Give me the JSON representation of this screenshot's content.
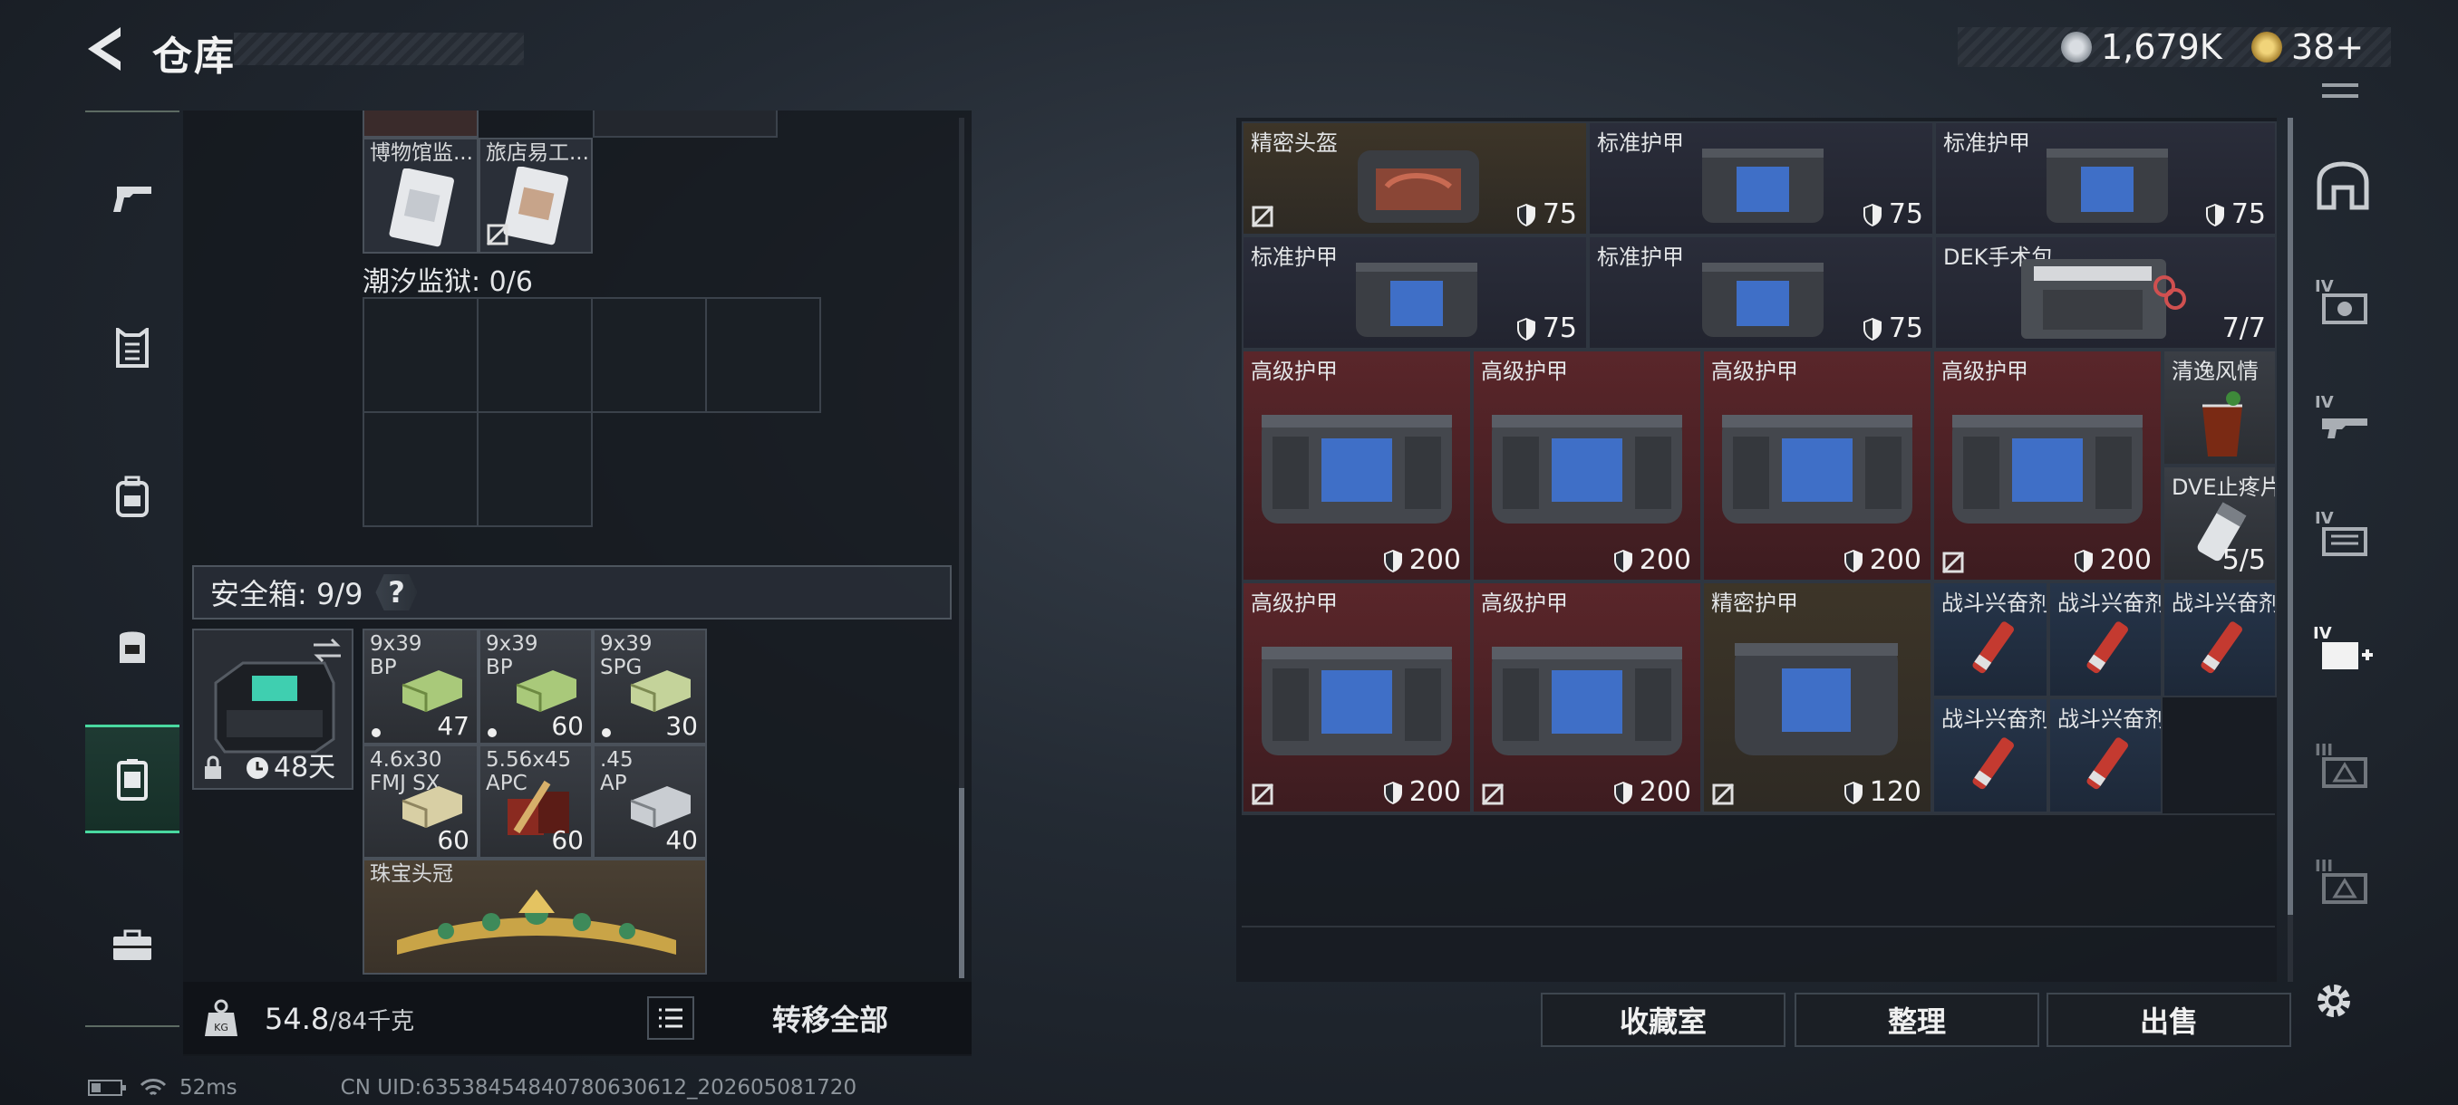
{
  "header": {
    "title": "仓库",
    "currency_silver": "1,679K",
    "currency_gold": "38+"
  },
  "sidebar": {
    "items": [
      "gun-icon",
      "armor-vest-icon",
      "backpack-icon",
      "rig-icon",
      "container-icon",
      "toolbox-icon"
    ]
  },
  "left": {
    "top_items": [
      {
        "name": "博物馆监..."
      },
      {
        "name": "旅店易工..."
      }
    ],
    "prison_label": "潮汐监狱: 0/6",
    "safe_label": "安全箱: 9/9",
    "safe_help": "?",
    "safe_days": "48天",
    "ammo": [
      {
        "name": "9x39\nBP",
        "qty": "47"
      },
      {
        "name": "9x39\nBP",
        "qty": "60"
      },
      {
        "name": "9x39\nSPG",
        "qty": "30"
      },
      {
        "name": "4.6x30\nFMJ SX",
        "qty": "60"
      },
      {
        "name": "5.56x45\nAPC",
        "qty": "60"
      },
      {
        "name": ".45\nAP",
        "qty": "40"
      }
    ],
    "crown_name": "珠宝头冠",
    "weight_value": "54.8",
    "weight_max": "/84千克",
    "transfer_all": "转移全部"
  },
  "right": {
    "items": [
      {
        "name": "精密头盔",
        "value": "75"
      },
      {
        "name": "标准护甲",
        "value": "75"
      },
      {
        "name": "标准护甲",
        "value": "75"
      },
      {
        "name": "标准护甲",
        "value": "75"
      },
      {
        "name": "标准护甲",
        "value": "75"
      },
      {
        "name": "DEK手术包",
        "value": "7/7"
      },
      {
        "name": "高级护甲",
        "value": "200"
      },
      {
        "name": "高级护甲",
        "value": "200"
      },
      {
        "name": "高级护甲",
        "value": "200"
      },
      {
        "name": "高级护甲",
        "value": "200"
      },
      {
        "name": "清逸风情",
        "value": ""
      },
      {
        "name": "DVE止疼片",
        "value": "5/5"
      },
      {
        "name": "高级护甲",
        "value": "200"
      },
      {
        "name": "高级护甲",
        "value": "200"
      },
      {
        "name": "精密护甲",
        "value": "120"
      },
      {
        "name": "战斗兴奋剂",
        "value": ""
      },
      {
        "name": "战斗兴奋剂",
        "value": ""
      },
      {
        "name": "战斗兴奋剂",
        "value": ""
      },
      {
        "name": "战斗兴奋剂",
        "value": ""
      },
      {
        "name": "战斗兴奋剂",
        "value": ""
      }
    ],
    "btn_collection": "收藏室",
    "btn_sort": "整理",
    "btn_sell": "出售",
    "side_tiers": [
      "IV",
      "IV",
      "IV",
      "IV+",
      "III",
      "III"
    ]
  },
  "footer": {
    "ping": "52ms",
    "uid": "CN UID:6353845484078063061​2_202605081720"
  }
}
